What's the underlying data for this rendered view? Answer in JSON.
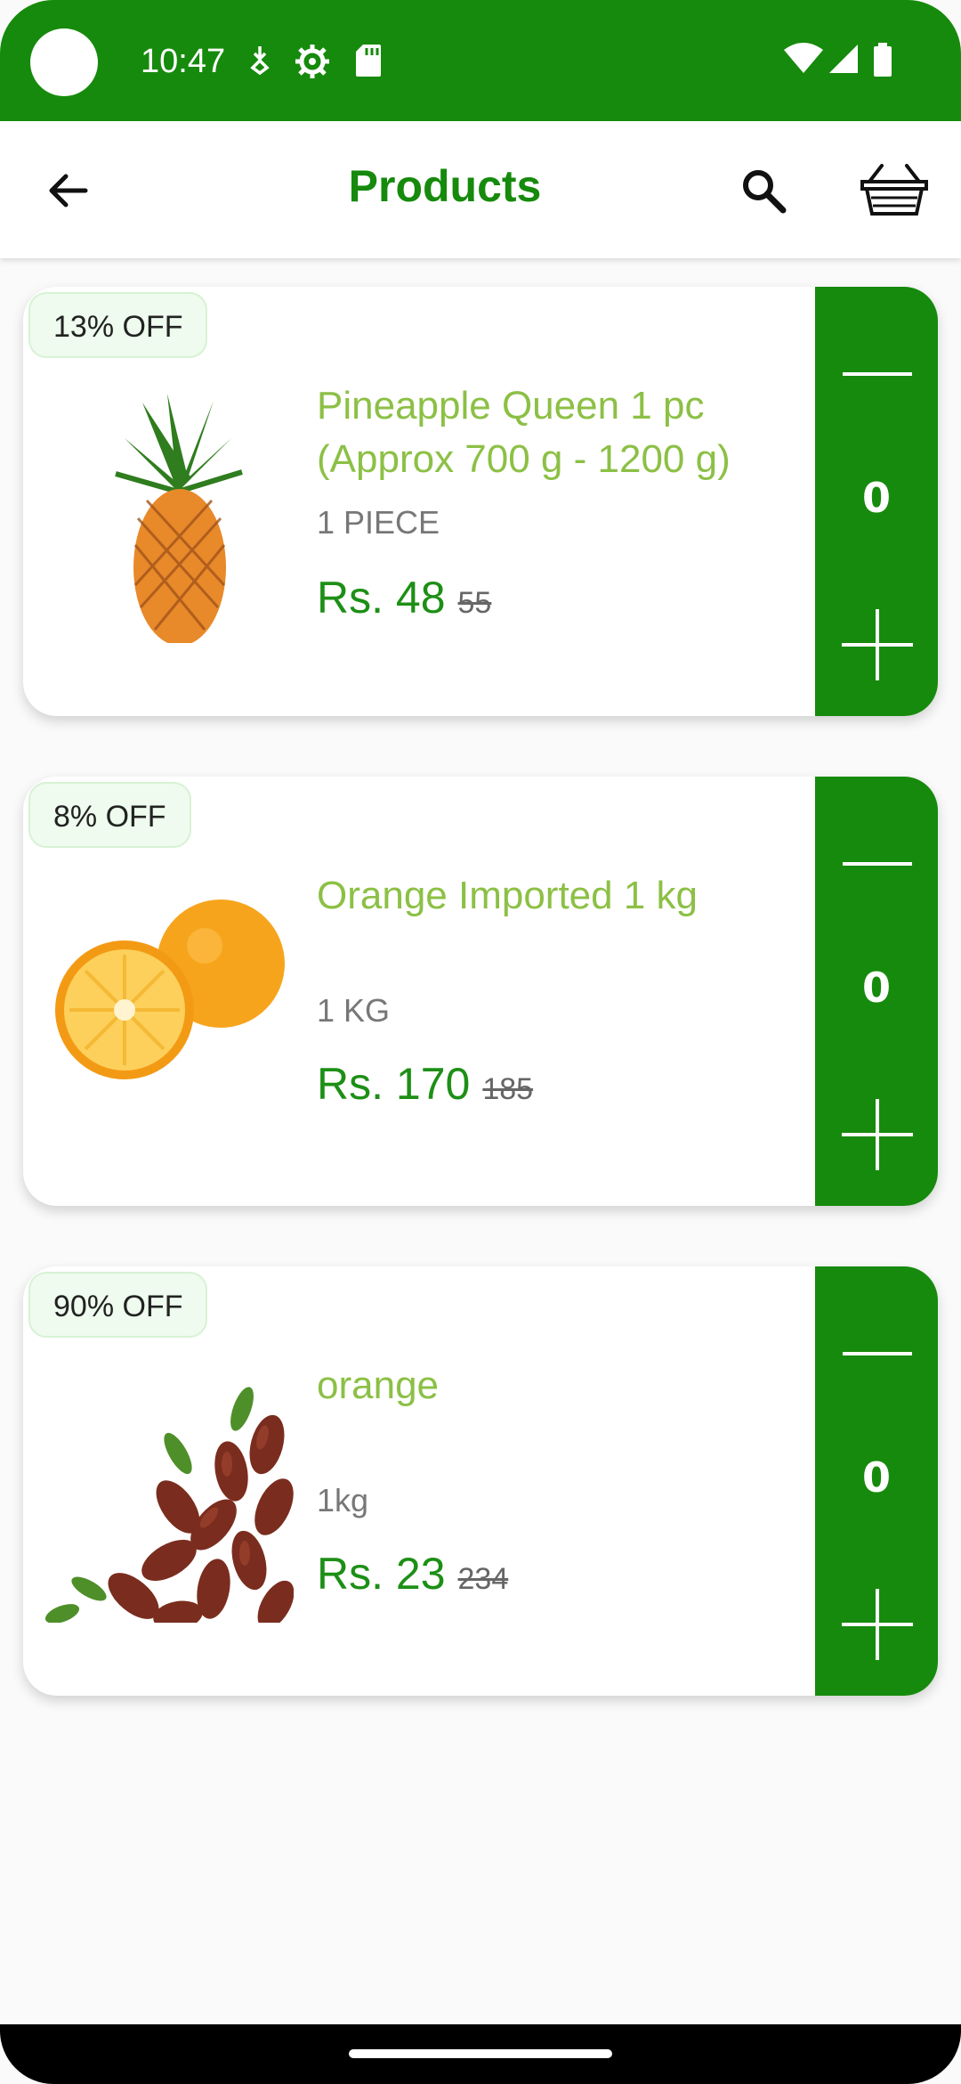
{
  "status_bar": {
    "time": "10:47"
  },
  "app_bar": {
    "title": "Products",
    "back_icon": "arrow-back-icon",
    "search_icon": "search-icon",
    "cart_icon": "basket-icon"
  },
  "colors": {
    "primary": "#168a0c",
    "product_name": "#8cc045",
    "price": "#1d8f16",
    "badge_bg": "#eefbee"
  },
  "products": [
    {
      "discount": "13% OFF",
      "name": "Pineapple Queen 1 pc (Approx 700 g - 1200 g)",
      "unit": "1 PIECE",
      "price": "Rs. 48",
      "mrp": "55",
      "quantity": "0",
      "image": "pineapple"
    },
    {
      "discount": "8% OFF",
      "name": "Orange Imported 1 kg",
      "unit": "1 KG",
      "price": "Rs. 170",
      "mrp": "185",
      "quantity": "0",
      "image": "orange"
    },
    {
      "discount": "90% OFF",
      "name": "orange",
      "unit": "1kg",
      "price": "Rs. 23",
      "mrp": "234",
      "quantity": "0",
      "image": "dates"
    }
  ]
}
